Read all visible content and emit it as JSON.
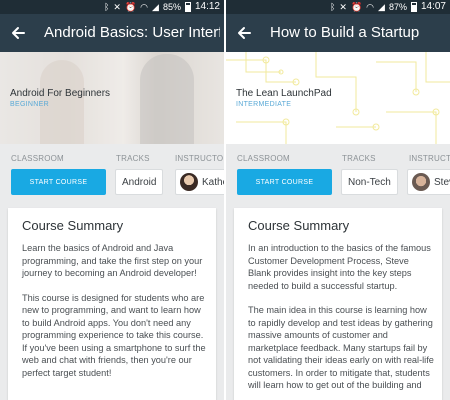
{
  "screens": [
    {
      "status": {
        "battery": "85%",
        "time": "14:12"
      },
      "appbar": {
        "title": "Android Basics: User Interf…"
      },
      "hero": {
        "title": "Android For Beginners",
        "level": "BEGINNER"
      },
      "labels": {
        "classroom": "CLASSROOM",
        "tracks": "TRACKS",
        "instructors": "INSTRUCTORS"
      },
      "start_button": "START COURSE",
      "track": "Android",
      "instructor": "Kathe",
      "summary": {
        "title": "Course Summary",
        "paragraphs": [
          "Learn the basics of Android and Java programming, and take the first step on your journey to becoming an Android developer!",
          "This course is designed for students who are new to programming, and want to learn how to build Android apps. You don't need any programming experience to take this course. If you've been using a smartphone to surf the web and chat with friends, then you're our perfect target student!"
        ]
      }
    },
    {
      "status": {
        "battery": "87%",
        "time": "14:07"
      },
      "appbar": {
        "title": "How to Build a Startup"
      },
      "hero": {
        "title": "The Lean LaunchPad",
        "level": "INTERMEDIATE"
      },
      "labels": {
        "classroom": "CLASSROOM",
        "tracks": "TRACKS",
        "instructors": "INSTRUCTO"
      },
      "start_button": "START COURSE",
      "track": "Non-Tech",
      "instructor": "Stev",
      "summary": {
        "title": "Course Summary",
        "paragraphs": [
          "In an introduction to the basics of the famous Customer Development Process, Steve Blank provides insight into the key steps needed to build a successful startup.",
          "The main idea in this course is learning how to rapidly develop and test ideas by gathering massive amounts of customer and marketplace feedback. Many startups fail by not validating their ideas early on with real-life customers. In order to mitigate that, students will learn how to get out of the building and"
        ]
      }
    }
  ],
  "colors": {
    "statusbar": "#1f2d36",
    "appbar": "#2c3e4b",
    "accent": "#19a9e3",
    "level_text": "#5aa9d6",
    "background": "#eaebec"
  },
  "icons": [
    "back-arrow-icon",
    "bluetooth-icon",
    "mute-icon",
    "alarm-icon",
    "wifi-icon",
    "signal-icon",
    "battery-icon"
  ]
}
